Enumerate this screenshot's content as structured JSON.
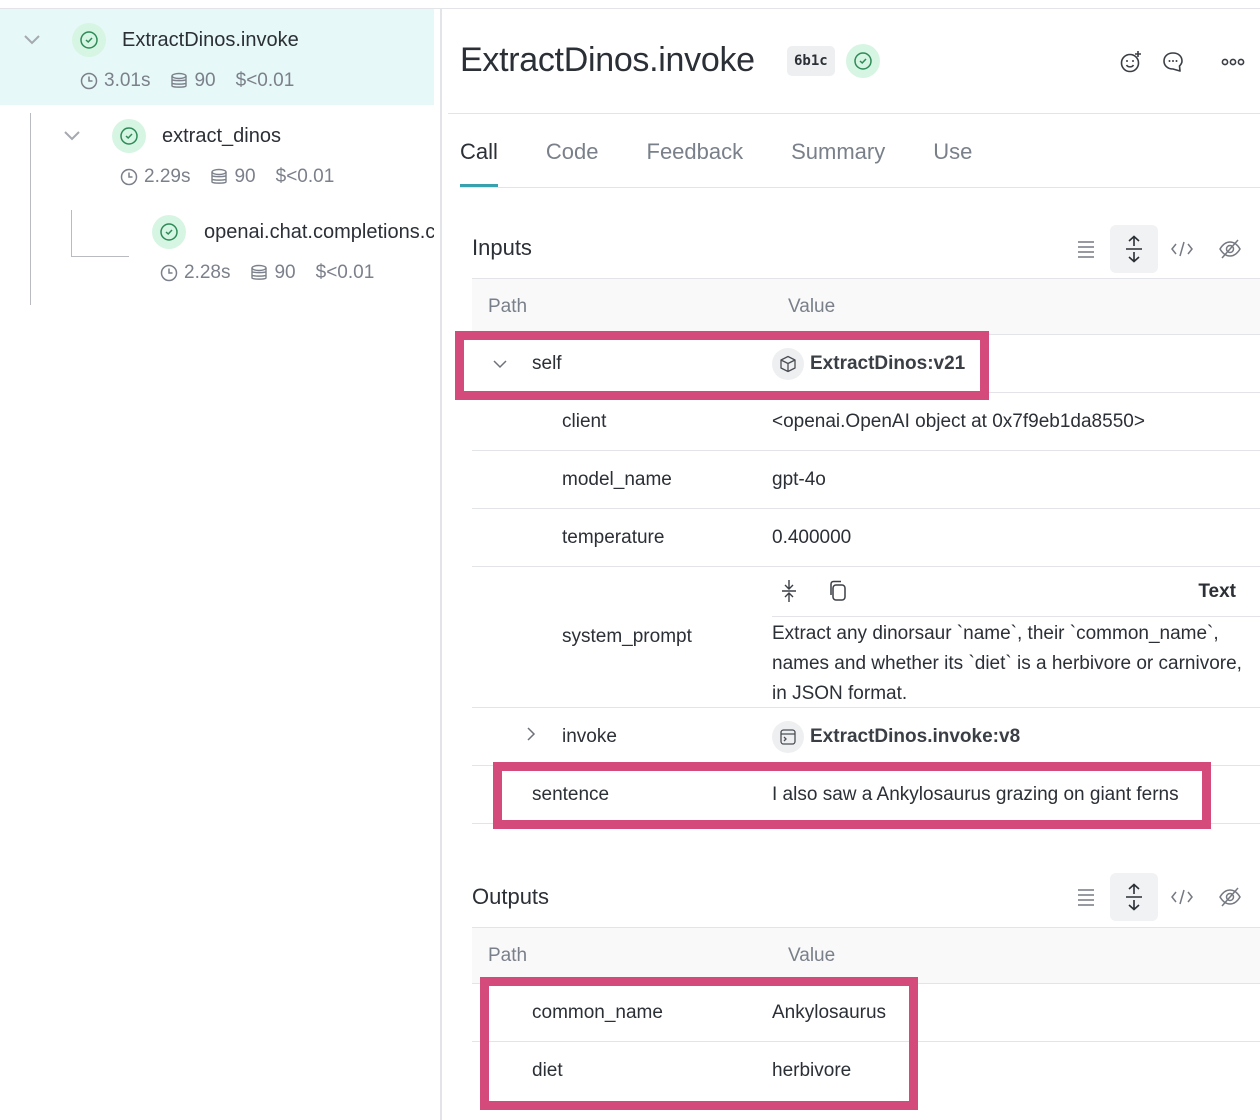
{
  "tree": {
    "nodes": [
      {
        "name": "ExtractDinos.invoke",
        "duration": "3.01s",
        "tokens": "90",
        "cost": "$<0.01",
        "expanded": true,
        "selected": true
      },
      {
        "name": "extract_dinos",
        "duration": "2.29s",
        "tokens": "90",
        "cost": "$<0.01",
        "expanded": true,
        "selected": false
      },
      {
        "name": "openai.chat.completions.create",
        "duration": "2.28s",
        "tokens": "90",
        "cost": "$<0.01",
        "expanded": false,
        "selected": false
      }
    ]
  },
  "header": {
    "title": "ExtractDinos.invoke",
    "hash": "6b1c",
    "status": "success",
    "icons": [
      "add-reaction-icon",
      "comment-icon",
      "more-icon"
    ]
  },
  "tabs": [
    {
      "label": "Call",
      "active": true
    },
    {
      "label": "Code",
      "active": false
    },
    {
      "label": "Feedback",
      "active": false
    },
    {
      "label": "Summary",
      "active": false
    },
    {
      "label": "Use",
      "active": false
    }
  ],
  "inputs": {
    "title": "Inputs",
    "columns": {
      "path": "Path",
      "value": "Value"
    },
    "rows": {
      "self": {
        "path": "self",
        "value": "ExtractDinos:v21"
      },
      "client": {
        "path": "client",
        "value": "<openai.OpenAI object at 0x7f9eb1da8550>"
      },
      "model_name": {
        "path": "model_name",
        "value": "gpt-4o"
      },
      "temperature": {
        "path": "temperature",
        "value": "0.400000"
      },
      "system_prompt": {
        "path": "system_prompt",
        "format_label": "Text",
        "value": "Extract any dinorsaur `name`, their `common_name`, names and whether its `diet` is a herbivore or carnivore, in JSON format."
      },
      "invoke": {
        "path": "invoke",
        "value": "ExtractDinos.invoke:v8"
      },
      "sentence": {
        "path": "sentence",
        "value": "I also saw a Ankylosaurus grazing on giant ferns"
      }
    }
  },
  "outputs": {
    "title": "Outputs",
    "columns": {
      "path": "Path",
      "value": "Value"
    },
    "rows": {
      "common_name": {
        "path": "common_name",
        "value": "Ankylosaurus"
      },
      "diet": {
        "path": "diet",
        "value": "herbivore"
      }
    }
  },
  "colors": {
    "accent": "#38a1ad",
    "success": "#2e8a57",
    "highlight": "#d44a7a",
    "selected_row": "#e6f8f8"
  }
}
